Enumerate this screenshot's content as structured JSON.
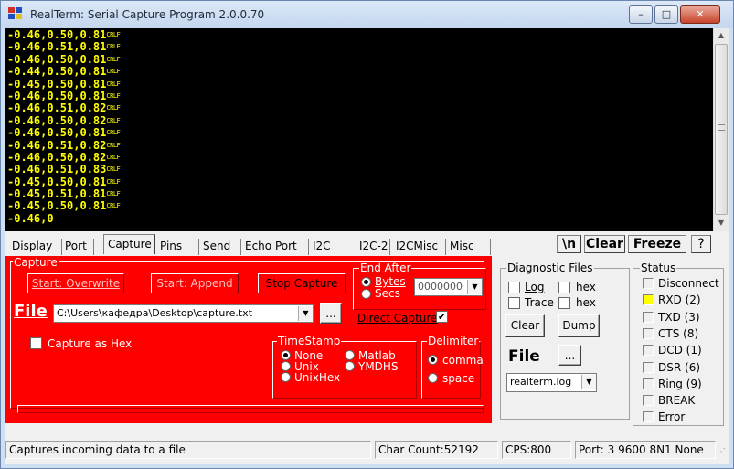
{
  "window": {
    "title": "RealTerm: Serial Capture Program 2.0.0.70"
  },
  "caption_buttons": {
    "minimize": "–",
    "maximize": "□",
    "close": "✕"
  },
  "terminal": {
    "crlf": "CRLF",
    "lines": [
      "0.46,0.50,0.81",
      "0.46,0.51,0.81",
      "0.46,0.50,0.81",
      "0.44,0.50,0.81",
      "0.45,0.50,0.81",
      "0.46,0.50,0.81",
      "0.46,0.51,0.82",
      "0.46,0.50,0.82",
      "0.46,0.50,0.81",
      "0.46,0.51,0.82",
      "0.46,0.50,0.82",
      "0.46,0.51,0.83",
      "0.45,0.50,0.81",
      "0.45,0.51,0.81",
      "0.45,0.50,0.81"
    ],
    "partial_line": "0.46,0"
  },
  "tabs": [
    "Display",
    "Port",
    "Capture",
    "Pins",
    "Send",
    "Echo Port",
    "I2C",
    "I2C-2",
    "I2CMisc",
    "Misc"
  ],
  "active_tab": "Capture",
  "toolbar": {
    "newline": "\\n",
    "clear": "Clear",
    "freeze": "Freeze",
    "help": "?"
  },
  "capture": {
    "group_label": "Capture",
    "start_overwrite": "Start: Overwrite",
    "start_append": "Start: Append",
    "stop": "Stop Capture",
    "file_label": "File",
    "file_path": "C:\\Users\\кафедра\\Desktop\\capture.txt",
    "browse": "...",
    "end_after_label": "End After",
    "bytes_label": "Bytes",
    "secs_label": "Secs",
    "end_after_value": "0000000",
    "direct_capture_label": "Direct Capture",
    "direct_capture_checked": true,
    "capture_as_hex_label": "Capture as Hex",
    "timestamp_label": "TimeStamp",
    "timestamp_options": [
      "None",
      "Unix",
      "UnixHex",
      "Matlab",
      "YMDHS"
    ],
    "timestamp_selected": "None",
    "delimiter_label": "Delimiter",
    "delimiter_options": [
      "comma",
      "space"
    ],
    "delimiter_selected": "comma"
  },
  "diagnostic": {
    "group_label": "Diagnostic Files",
    "log_label": "Log",
    "trace_label": "Trace",
    "hex_label": "hex",
    "clear": "Clear",
    "dump": "Dump",
    "file_label": "File",
    "browse": "...",
    "logfile": "realterm.log"
  },
  "status": {
    "group_label": "Status",
    "items": [
      "Disconnect",
      "RXD (2)",
      "TXD (3)",
      "CTS (8)",
      "DCD (1)",
      "DSR (6)",
      "Ring (9)",
      "BREAK",
      "Error"
    ],
    "lit": [
      "RXD (2)"
    ],
    "led_on_color": "#ffff00"
  },
  "statusbar": {
    "message": "Captures incoming data to a file",
    "char_count": "Char Count:52192",
    "cps": "CPS:800",
    "port": "Port: 3 9600 8N1 None"
  },
  "colors": {
    "terminal_bg": "#000000",
    "terminal_text": "#ffff00",
    "capture_panel": "#ff0000"
  }
}
